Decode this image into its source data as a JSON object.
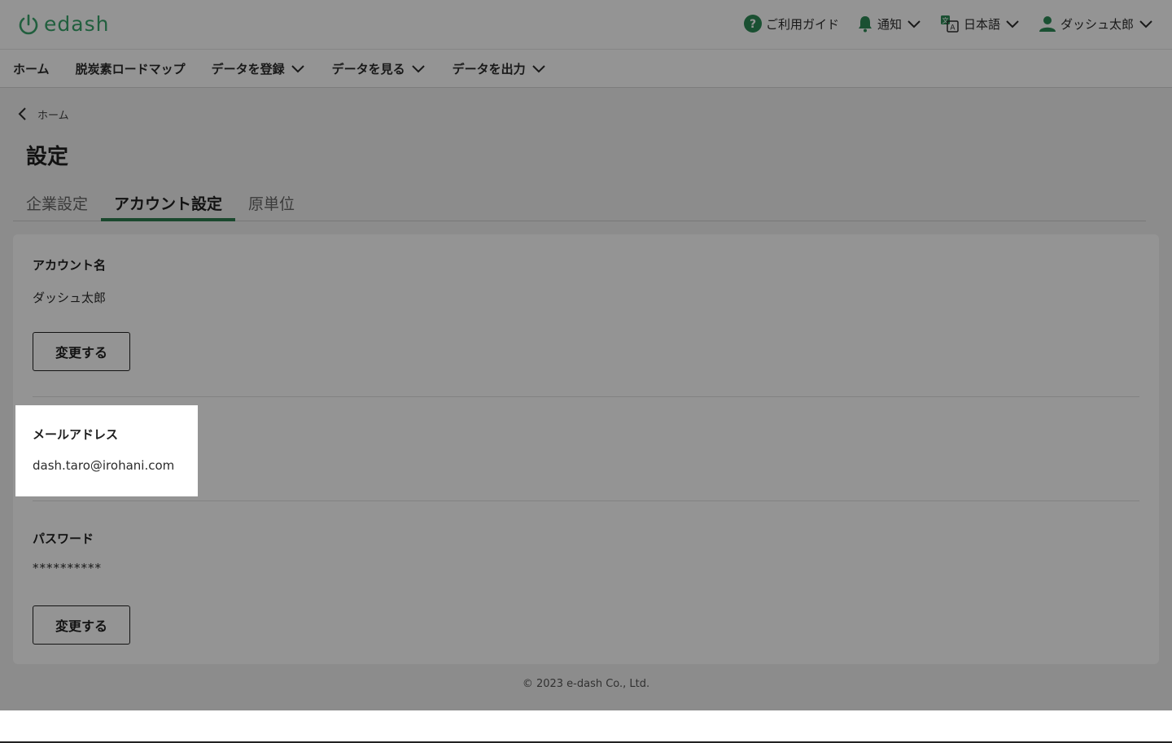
{
  "brand": {
    "logo_text": "edash",
    "accent": "#3aa46b",
    "tab_active": "#2e7d4f"
  },
  "header": {
    "guide_label": "ご利用ガイド",
    "notify_label": "通知",
    "language_label": "日本語",
    "user_label": "ダッシュ太郎"
  },
  "nav": {
    "home": "ホーム",
    "roadmap": "脱炭素ロードマップ",
    "register": "データを登録",
    "view": "データを見る",
    "export": "データを出力"
  },
  "breadcrumb": {
    "back_label": "ホーム"
  },
  "page": {
    "title": "設定"
  },
  "tabs": [
    {
      "label": "企業設定",
      "active": false
    },
    {
      "label": "アカウント設定",
      "active": true
    },
    {
      "label": "原単位",
      "active": false
    }
  ],
  "account": {
    "name_label": "アカウント名",
    "name_value": "ダッシュ太郎",
    "name_change": "変更する",
    "email_label": "メールアドレス",
    "email_value": "dash.taro@irohani.com",
    "password_label": "パスワード",
    "password_value": "**********",
    "password_change": "変更する"
  },
  "footer": {
    "copyright": "© 2023 e-dash Co., Ltd."
  }
}
